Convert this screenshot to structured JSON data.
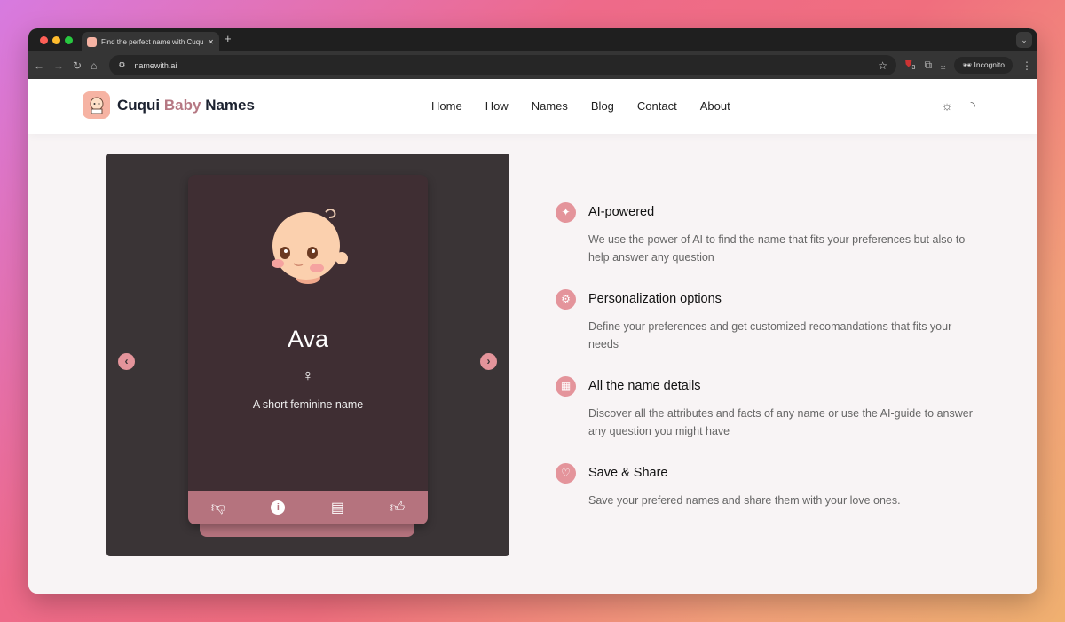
{
  "browser": {
    "tab_title": "Find the perfect name with Cuqui Baby Names",
    "url": "namewith.ai",
    "incognito_label": "Incognito",
    "extension_badge": "3"
  },
  "header": {
    "brand_part1": "Cuqui",
    "brand_part2": "Baby",
    "brand_part3": "Names",
    "nav": [
      "Home",
      "How",
      "Names",
      "Blog",
      "Contact",
      "About"
    ]
  },
  "card": {
    "name": "Ava",
    "gender_symbol": "♀",
    "description": "A short feminine name",
    "actions": [
      "thumbs-down-icon",
      "info-icon",
      "comment-icon",
      "thumbs-up-icon"
    ]
  },
  "features": [
    {
      "icon": "magic-wand-icon",
      "title": "AI-powered",
      "text": "We use the power of AI to find the name that fits your preferences but also to help answer any question"
    },
    {
      "icon": "gear-icon",
      "title": "Personalization options",
      "text": "Define your preferences and get customized recomandations that fits your needs"
    },
    {
      "icon": "layout-icon",
      "title": "All the name details",
      "text": "Discover all the attributes and facts of any name or use the AI-guide to answer any question you might have"
    },
    {
      "icon": "heart-icon",
      "title": "Save & Share",
      "text": "Save your prefered names and share them with your love ones."
    }
  ],
  "colors": {
    "accent": "#e4949b",
    "card_footer": "#b5737e",
    "brand_pink": "#b57883"
  }
}
